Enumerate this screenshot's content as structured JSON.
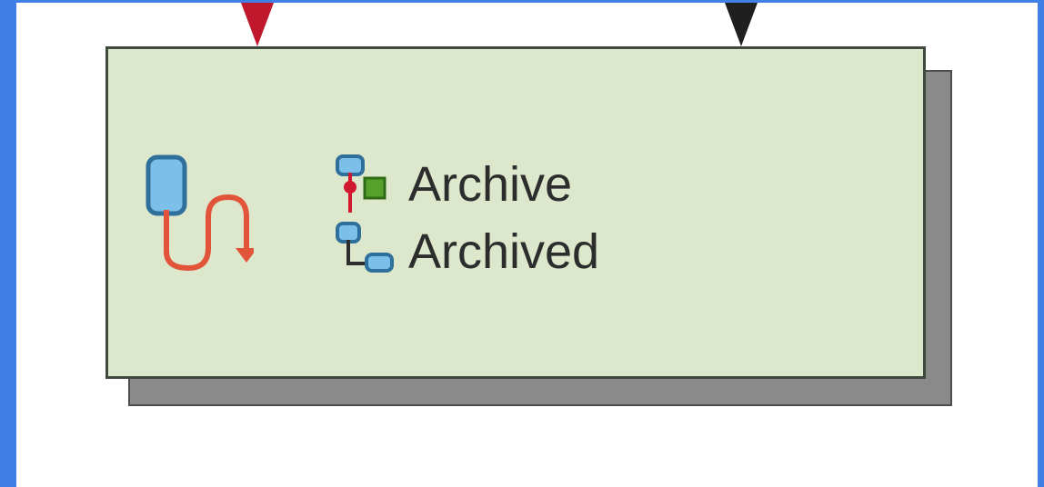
{
  "node": {
    "rows": [
      {
        "label": "Archive",
        "icon": "rule-decision-icon"
      },
      {
        "label": "Archived",
        "icon": "state-flow-icon"
      }
    ],
    "main_icon": "process-flow-icon",
    "background_color": "#dce7cb",
    "border_color": "#3f4a3f",
    "shadow_color": "#8a8a8a"
  },
  "connectors": {
    "incoming_color": "#c0182d",
    "outgoing_color": "#1f1f1f"
  },
  "frame_color": "#3f7fe6"
}
